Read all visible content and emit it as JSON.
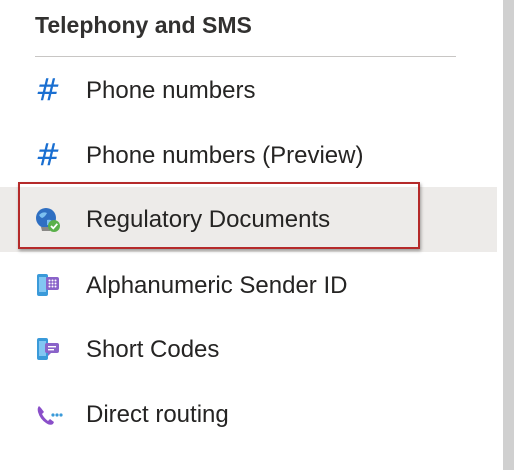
{
  "section": {
    "title": "Telephony and SMS"
  },
  "nav": {
    "items": [
      {
        "label": "Phone numbers",
        "icon": "hash-icon"
      },
      {
        "label": "Phone numbers (Preview)",
        "icon": "hash-icon"
      },
      {
        "label": "Regulatory Documents",
        "icon": "globe-check-icon",
        "selected": true
      },
      {
        "label": "Alphanumeric Sender ID",
        "icon": "phone-dialpad-icon"
      },
      {
        "label": "Short Codes",
        "icon": "phone-message-icon"
      },
      {
        "label": "Direct routing",
        "icon": "call-routing-icon"
      }
    ]
  },
  "colors": {
    "accent_blue": "#1a6fd1",
    "selected_bg": "#edebe9",
    "highlight_border": "#b52a2a",
    "text": "#252423"
  }
}
